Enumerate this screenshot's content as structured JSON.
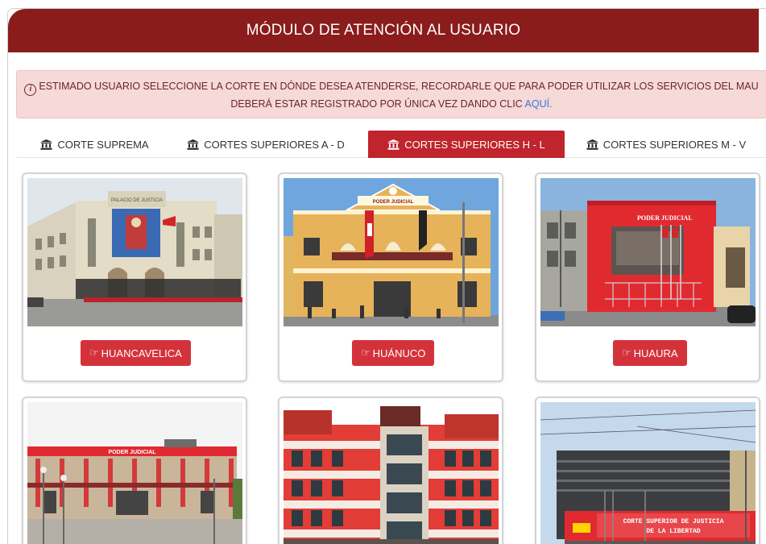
{
  "header": {
    "title": "MÓDULO DE ATENCIÓN AL USUARIO"
  },
  "alert": {
    "line1": "ESTIMADO USUARIO SELECCIONE LA CORTE EN DÓNDE DESEA ATENDERSE, RECORDARLE QUE PARA PODER UTILIZAR LOS SERVICIOS DEL MAU",
    "line2": "DEBERÁ ESTAR REGISTRADO POR ÚNICA VEZ DANDO CLIC",
    "link": "AQUÍ."
  },
  "tabs": [
    {
      "label": "CORTE SUPREMA",
      "icon": "bank-icon",
      "active": false
    },
    {
      "label": "CORTES SUPERIORES A - D",
      "icon": "bank-icon",
      "active": false
    },
    {
      "label": "CORTES SUPERIORES H - L",
      "icon": "bank-icon",
      "active": true
    },
    {
      "label": "CORTES SUPERIORES M - V",
      "icon": "bank-icon",
      "active": false
    }
  ],
  "courts": [
    {
      "label": "HUANCAVELICA",
      "image": "court-building-photo"
    },
    {
      "label": "HUÁNUCO",
      "image": "court-building-photo"
    },
    {
      "label": "HUAURA",
      "image": "court-building-photo"
    },
    {
      "image": "court-building-photo"
    },
    {
      "image": "court-building-photo"
    },
    {
      "image": "court-building-photo"
    }
  ],
  "photo_text": {
    "huancavelica_sign": "PALACIO DE JUSTICIA",
    "huanuco_sign": "PODER JUDICIAL",
    "huaura_sign": "PODER JUDICIAL",
    "lima_sign": "PODER JUDICIAL",
    "libertad_sign_line1": "CORTE SUPERIOR DE JUSTICIA",
    "libertad_sign_line2": "DE LA LIBERTAD"
  },
  "colors": {
    "header_bg": "#8b1c1c",
    "active_tab": "#c0242c",
    "button": "#d4323b",
    "alert_bg": "#f6d9d9",
    "link": "#2f7bd6"
  }
}
